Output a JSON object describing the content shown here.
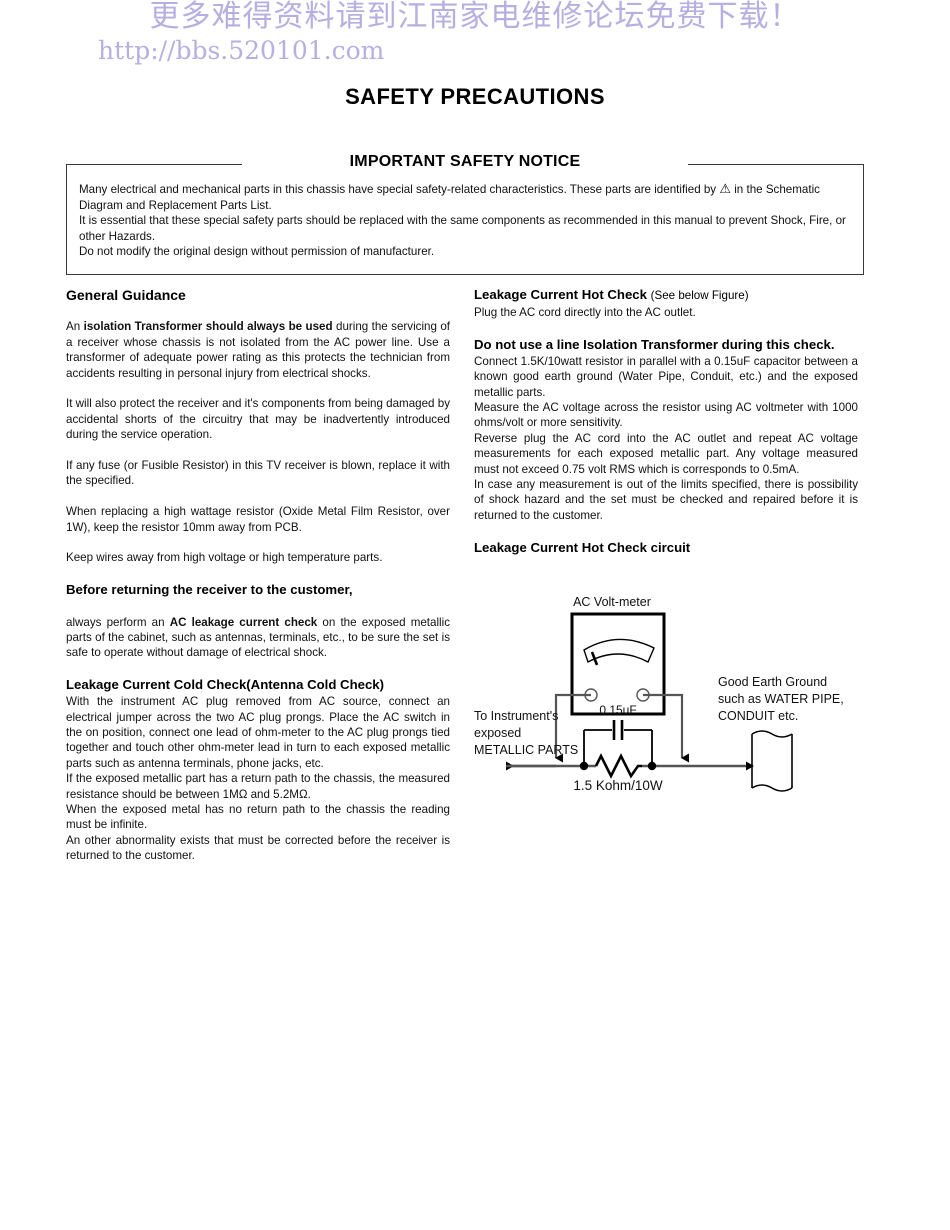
{
  "watermark": {
    "chinese": "更多难得资料请到江南家电维修论坛免费下载！",
    "url": "http://bbs.520101.com",
    "color": "#b7aee2"
  },
  "page_title": "SAFETY PRECAUTIONS",
  "notice": {
    "title": "IMPORTANT SAFETY NOTICE",
    "line1_a": "Many electrical and mechanical parts in this chassis have special safety-related characteristics. These parts are identified by",
    "warn_icon": "⚠",
    "line1_b": "in the Schematic Diagram and Replacement Parts List.",
    "line2": "It is essential that these special safety parts should be replaced with the same components as recommended in this manual to prevent Shock, Fire, or other Hazards.",
    "line3": "Do not modify the original design without permission of manufacturer."
  },
  "left_column": {
    "heading": "General Guidance",
    "p1_bold_lead": "An ",
    "p1_bold": "isolation Transformer should always be used",
    "p1_rest": " during the servicing of a receiver whose chassis is not isolated from the AC power line. Use a transformer of adequate power rating as this protects the technician from accidents resulting in personal injury from electrical shocks.",
    "p2": "It will also protect the receiver and it's components from being damaged by accidental shorts of the circuitry that may be inadvertently introduced during the service operation.",
    "p3": "If any fuse (or Fusible Resistor) in this TV receiver is blown, replace it with the specified.",
    "p4": "When replacing a high wattage resistor (Oxide Metal Film Resistor, over 1W), keep the resistor 10mm away from PCB.",
    "p5": "Keep wires away from high voltage or high temperature parts.",
    "heading2": "Before returning the receiver to the customer,",
    "p6_lead": "always perform an ",
    "p6_bold": "AC leakage current check",
    "p6_rest": " on the exposed metallic parts of the cabinet, such as antennas, terminals, etc., to be sure the set is safe to operate without damage of electrical shock.",
    "heading3": "Leakage Current Cold Check(Antenna Cold Check)",
    "p7": "With the instrument AC plug removed from AC source, connect an electrical jumper across the two AC plug prongs. Place the AC switch in the on position, connect one lead of ohm-meter to the AC plug prongs tied together and touch other ohm-meter lead in turn to each exposed metallic parts such as antenna terminals, phone jacks, etc.",
    "p8": "If the exposed metallic part has a return path to the chassis, the measured resistance should be between 1MΩ and 5.2MΩ.",
    "p9": "When the exposed metal has no return path to the chassis the reading must be infinite.",
    "p10": "An other abnormality exists that must be corrected before the receiver is returned to the customer."
  },
  "right_column": {
    "heading": "Leakage Current Hot Check",
    "heading_note": "(See below Figure)",
    "p1": "Plug the AC cord directly into the AC outlet.",
    "heading2": "Do not use a line Isolation Transformer during this check.",
    "p2": "Connect 1.5K/10watt resistor in parallel with a 0.15uF capacitor between a known good earth ground (Water Pipe, Conduit, etc.) and the exposed metallic parts.",
    "p3": "Measure the AC voltage across the resistor using AC voltmeter with 1000 ohms/volt or more sensitivity.",
    "p4": "Reverse plug the AC cord into the AC outlet and repeat AC voltage measurements for each exposed metallic part. Any voltage measured must not exceed 0.75 volt RMS which is corresponds to 0.5mA.",
    "p5": "In case any measurement is out of the limits specified, there is possibility of shock hazard and the set must be checked and repaired before it is returned to the customer.",
    "heading3": "Leakage Current Hot Check circuit"
  },
  "circuit": {
    "meter_label": "AC Volt-meter",
    "capacitor_label": "0.15uF",
    "resistor_label": "1.5 Kohm/10W",
    "left_label_line1": "To Instrument's",
    "left_label_line2": "exposed",
    "left_label_line3": "METALLIC PARTS",
    "right_label_line1": "Good Earth Ground",
    "right_label_line2": "such as WATER PIPE,",
    "right_label_line3": "CONDUIT etc."
  }
}
